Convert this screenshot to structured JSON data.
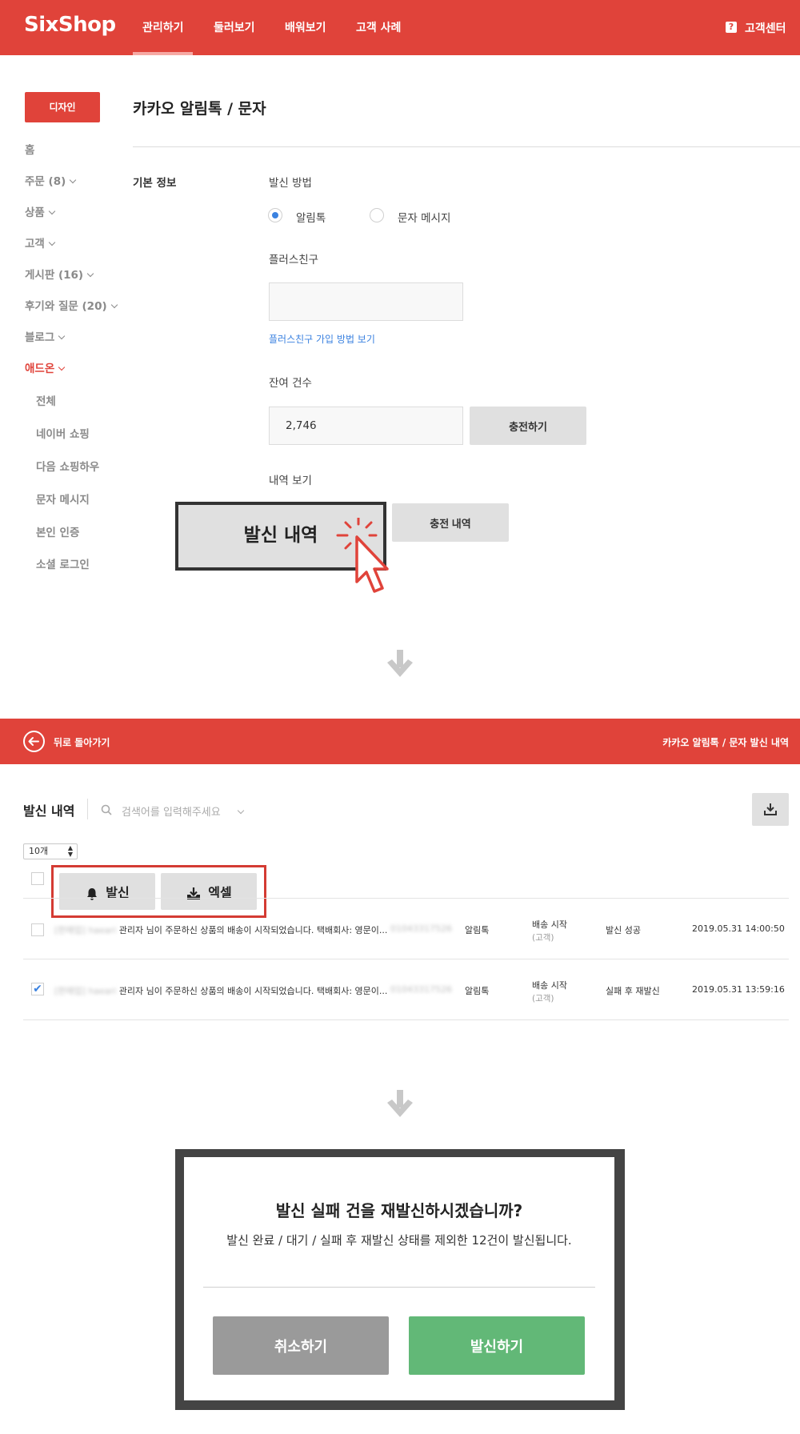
{
  "brand": "SixShop",
  "nav": {
    "items": [
      "관리하기",
      "둘러보기",
      "배워보기",
      "고객 사례"
    ],
    "help": "고객센터"
  },
  "sidebar": {
    "design_button": "디자인",
    "items": [
      "홈",
      "주문 (8)",
      "상품",
      "고객",
      "게시판 (16)",
      "후기와 질문 (20)",
      "블로그",
      "애드온"
    ],
    "subitems": [
      "전체",
      "네이버 쇼핑",
      "다음 쇼핑하우",
      "문자 메시지",
      "본인 인증",
      "소셜 로그인"
    ]
  },
  "main": {
    "title": "카카오 알림톡 / 문자",
    "section": "기본 정보",
    "send_method": {
      "label": "발신 방법",
      "options": [
        "알림톡",
        "문자 메시지"
      ],
      "selected": "알림톡"
    },
    "plus_friend": {
      "label": "플러스친구",
      "value": "",
      "link": "플러스친구 가입 방법 보기"
    },
    "remaining": {
      "label": "잔여 건수",
      "value": "2,746",
      "charge_button": "충전하기"
    },
    "history": {
      "label": "내역 보기",
      "send_history_button": "발신 내역",
      "charge_history_button": "충전 내역"
    }
  },
  "history_page": {
    "back": "뒤로 돌아가기",
    "breadcrumb": "카카오 알림톡 / 문자 발신 내역",
    "title": "발신 내역",
    "search_placeholder": "검색어를 입력해주세요",
    "page_size": "10개",
    "actions": [
      "발신",
      "엑셀"
    ],
    "rows": [
      {
        "sender": "[판매업] haeari",
        "message": "관리자 님이 주문하신 상품의 배송이 시작되었습니다. 택배회사: 영문이...",
        "phone": "01043317526",
        "channel": "알림톡",
        "event": "배송 시작",
        "target": "(고객)",
        "status": "발신 성공",
        "time": "2019.05.31 14:00:50",
        "checked": false
      },
      {
        "sender": "[판매업] haeari",
        "message": "관리자 님이 주문하신 상품의 배송이 시작되었습니다. 택배회사: 영문이...",
        "phone": "01043317526",
        "channel": "알림톡",
        "event": "배송 시작",
        "target": "(고객)",
        "status": "실패 후 재발신",
        "time": "2019.05.31 13:59:16",
        "checked": true
      }
    ]
  },
  "modal": {
    "title": "발신 실패 건을 재발신하시겠습니까?",
    "description": "발신 완료 / 대기 / 실패 후 재발신 상태를 제외한 12건이 발신됩니다.",
    "cancel": "취소하기",
    "confirm": "발신하기"
  },
  "colors": {
    "brand_red": "#e0433a",
    "radio_blue": "#3b82e0",
    "confirm_green": "#62b877",
    "cancel_gray": "#9a9a9a"
  }
}
